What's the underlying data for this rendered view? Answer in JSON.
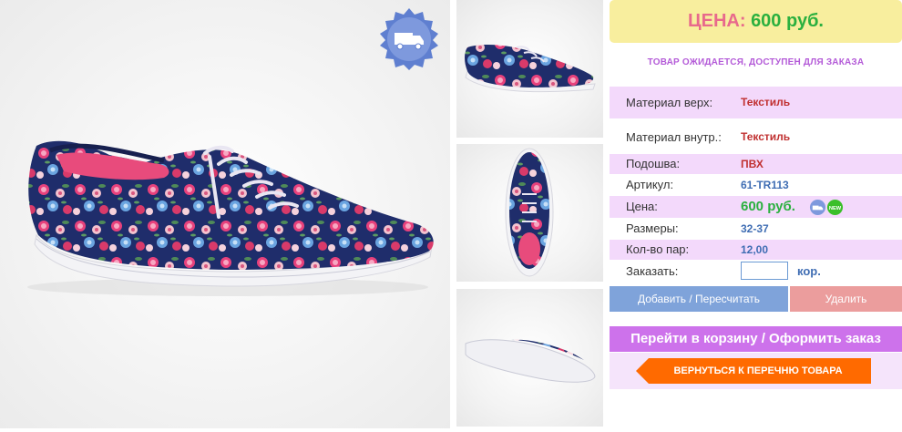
{
  "product": {
    "price_label": "ЦЕНА:",
    "price_value": "600 руб.",
    "status": "ТОВАР ОЖИДАЕТСЯ, ДОСТУПЕН ДЛЯ ЗАКАЗА"
  },
  "specs": [
    {
      "label": "Материал верх:",
      "value": "Текстиль"
    },
    {
      "label": "Материал внутр.:",
      "value": "Текстиль"
    },
    {
      "label": "Подошва:",
      "value": "ПВХ"
    },
    {
      "label": "Артикул:",
      "value": "61-TR113"
    },
    {
      "label": "Цена:",
      "value": "600 руб."
    },
    {
      "label": "Размеры:",
      "value": "32-37"
    },
    {
      "label": "Кол-во пар:",
      "value": "12,00"
    }
  ],
  "order": {
    "label": "Заказать:",
    "quantity_value": "",
    "unit": "кор."
  },
  "buttons": {
    "add": "Добавить / Пересчитать",
    "delete": "Удалить",
    "cart": "Перейти в корзину / Оформить заказ",
    "back": "ВЕРНУТЬСЯ К ПЕРЕЧНЮ ТОВАРА"
  },
  "icons": {
    "badge": "delivery-truck-icon",
    "mini": [
      "delivery-small-icon",
      "new-badge-icon"
    ],
    "new_text": "NEW"
  },
  "colors": {
    "price_box_bg": "#f8ee9e",
    "price_label": "#e8698c",
    "price_value": "#2bb03f",
    "row_pink": "#f3d9fb",
    "add_button": "#7fa3da",
    "delete_button": "#eb9d9d",
    "cart_button": "#cd72eb",
    "back_button": "#ff6a00"
  }
}
